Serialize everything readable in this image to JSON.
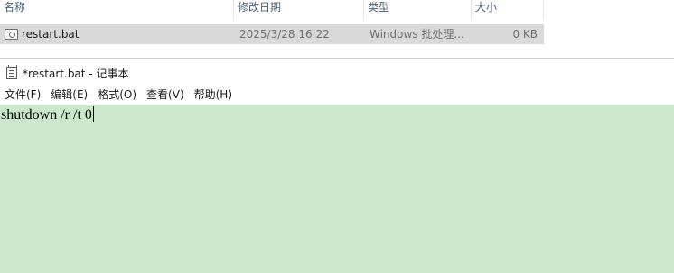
{
  "explorer": {
    "columns": {
      "name": "名称",
      "date": "修改日期",
      "type": "类型",
      "size": "大小"
    },
    "files": [
      {
        "icon": "bat-file-icon",
        "name": "restart.bat",
        "date": "2025/3/28 16:22",
        "type": "Windows 批处理...",
        "size": "0 KB"
      }
    ]
  },
  "notepad": {
    "title": "*restart.bat - 记事本",
    "menu": [
      "文件(F)",
      "编辑(E)",
      "格式(O)",
      "查看(V)",
      "帮助(H)"
    ],
    "content": "shutdown /r /t 0",
    "editor_background": "#cce8cc"
  }
}
